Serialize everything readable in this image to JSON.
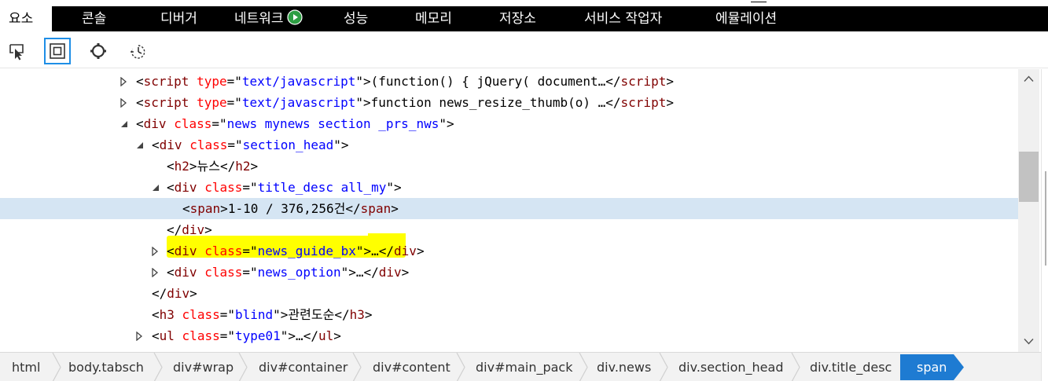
{
  "tabs": [
    {
      "label": "요소",
      "active": true
    },
    {
      "label": "콘솔"
    },
    {
      "label": "디버거"
    },
    {
      "label": "네트워크"
    },
    {
      "label": "성능"
    },
    {
      "label": "메모리"
    },
    {
      "label": "저장소"
    },
    {
      "label": "서비스 작업자"
    },
    {
      "label": "에뮬레이션"
    }
  ],
  "toolbar": {
    "icons": [
      "select-element-icon",
      "highlight-box-icon",
      "color-picker-icon",
      "timer-icon"
    ]
  },
  "dom_tree": {
    "selected_row": 6,
    "rows": [
      {
        "twisty": "collapsed",
        "tag_open": "script",
        "attrs": [
          {
            "n": "type",
            "v": "text/javascript"
          }
        ],
        "text": "(function() { jQuery( document…",
        "tag_close": "script"
      },
      {
        "twisty": "collapsed",
        "tag_open": "script",
        "attrs": [
          {
            "n": "type",
            "v": "text/javascript"
          }
        ],
        "text": "function news_resize_thumb(o) …",
        "tag_close": "script"
      },
      {
        "twisty": "expanded",
        "tag_open": "div",
        "attrs": [
          {
            "n": "class",
            "v": "news mynews section _prs_nws"
          }
        ]
      },
      {
        "twisty": "expanded",
        "tag_open": "div",
        "attrs": [
          {
            "n": "class",
            "v": "section_head"
          }
        ]
      },
      {
        "tag_open": "h2",
        "text": "뉴스",
        "tag_close": "h2"
      },
      {
        "twisty": "expanded",
        "tag_open": "div",
        "attrs": [
          {
            "n": "class",
            "v": "title_desc all_my"
          }
        ]
      },
      {
        "tag_open": "span",
        "text": "1-10 / 376,256건",
        "tag_close": "span"
      },
      {
        "tag_close": "div"
      },
      {
        "twisty": "collapsed",
        "tag_open": "div",
        "attrs": [
          {
            "n": "class",
            "v": "news_guide_bx"
          }
        ],
        "text": "…",
        "tag_close": "div"
      },
      {
        "twisty": "collapsed",
        "tag_open": "div",
        "attrs": [
          {
            "n": "class",
            "v": "news_option"
          }
        ],
        "text": "…",
        "tag_close": "div"
      },
      {
        "tag_close": "div"
      },
      {
        "tag_open": "h3",
        "attrs": [
          {
            "n": "class",
            "v": "blind"
          }
        ],
        "text": "관련도순",
        "tag_close": "h3"
      },
      {
        "twisty": "collapsed",
        "tag_open": "ul",
        "attrs": [
          {
            "n": "class",
            "v": "type01"
          }
        ],
        "text": "…",
        "tag_close": "ul"
      }
    ]
  },
  "breadcrumbs": [
    "html",
    "body.tabsch",
    "div#wrap",
    "div#container",
    "div#content",
    "div#main_pack",
    "div.news",
    "div.section_head",
    "div.title_desc",
    "span"
  ],
  "colors": {
    "tag": "#800000",
    "attr_name": "#ff0000",
    "attr_value": "#0000ff",
    "selected_row": "#d5e5f3",
    "highlight": "#ffff00",
    "active_crumb": "#1e7bd2",
    "network_play": "#2e9e44"
  }
}
